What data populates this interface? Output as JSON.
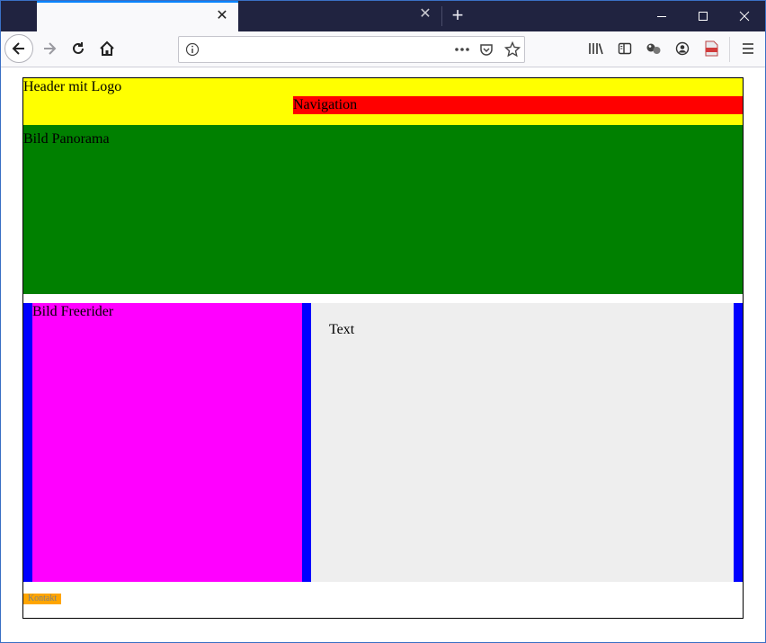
{
  "browser": {
    "tabs": [
      {
        "title": "",
        "active": true
      },
      {
        "title": "",
        "active": false
      }
    ],
    "close_tab_glyph": "✕",
    "new_tab_glyph": "+",
    "window_controls": {
      "minimize": "—",
      "maximize": "☐",
      "close": "✕"
    },
    "address_bar": {
      "value": "",
      "placeholder": ""
    }
  },
  "page": {
    "header_label": "Header mit Logo",
    "navigation_label": "Navigation",
    "panorama_label": "Bild Panorama",
    "freerider_label": "Bild Freerider",
    "text_label": "Text",
    "footer_link": "Kontakt"
  },
  "colors": {
    "header": "#ffff00",
    "navigation": "#ff0000",
    "panorama": "#008000",
    "content_bg": "#0000ff",
    "freerider": "#ff00ff",
    "text_area": "#eeeeee",
    "footer_link_bg": "#ffa500",
    "tabstrip": "#202340"
  },
  "icons": [
    "back-arrow-icon",
    "forward-arrow-icon",
    "reload-icon",
    "home-icon",
    "info-icon",
    "more-icon",
    "pocket-icon",
    "bookmark-star-icon",
    "library-icon",
    "sidebar-icon",
    "extension-icon",
    "account-icon",
    "pdf-icon",
    "menu-icon"
  ]
}
